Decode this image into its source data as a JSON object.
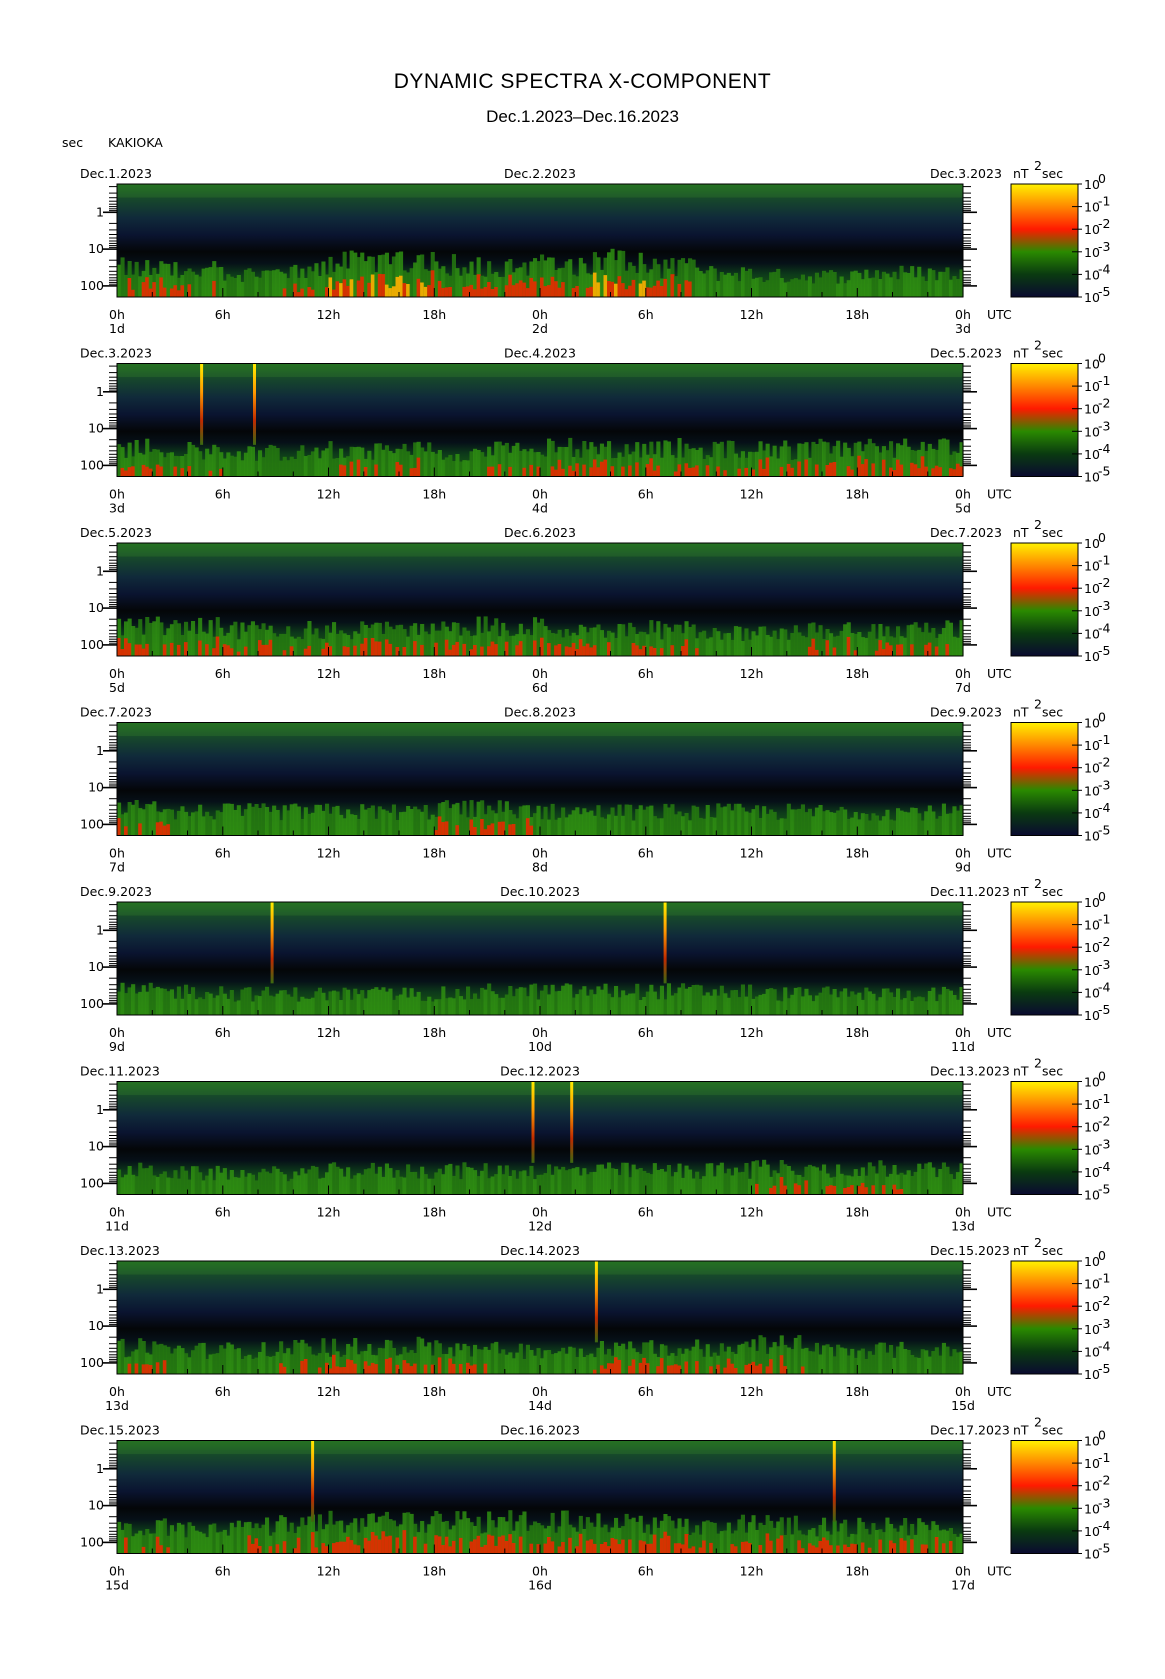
{
  "header": {
    "title": "DYNAMIC SPECTRA X-COMPONENT",
    "subtitle": "Dec.1.2023–Dec.16.2023",
    "unit_label": "sec",
    "station": "KAKIOKA"
  },
  "chart_data": {
    "type": "heatmap",
    "title": "DYNAMIC SPECTRA X-COMPONENT",
    "subtitle": "Dec.1.2023–Dec.16.2023",
    "station": "KAKIOKA",
    "ylabel": "sec",
    "y_ticks": [
      "1",
      "10",
      "100"
    ],
    "x_ticks": [
      "0h",
      "6h",
      "12h",
      "18h",
      "0h",
      "6h",
      "12h",
      "18h",
      "0h"
    ],
    "x_unit": "UTC",
    "colorbar": {
      "label": "nT",
      "label_exp": "2",
      "label_unit": "sec",
      "ticks": [
        "10",
        "10",
        "10",
        "10",
        "10",
        "10"
      ],
      "exponents": [
        "0",
        "-1",
        "-2",
        "-3",
        "-4",
        "-5"
      ],
      "colors": [
        "#fff200",
        "#ff8800",
        "#ff1a00",
        "#2a8a00",
        "#0a3a10",
        "#0a0a30"
      ]
    },
    "panels": [
      {
        "start": "Dec.1.2023",
        "mid": "Dec.2.2023",
        "end": "Dec.3.2023",
        "day_left": "1d",
        "day_mid": "2d",
        "day_right": "3d",
        "events": [],
        "activity": [
          0.6,
          0.5,
          0.4,
          0.5,
          0.8,
          0.9,
          0.7,
          0.6,
          0.7,
          0.9,
          0.6,
          0.4,
          0.3,
          0.3,
          0.4,
          0.4
        ]
      },
      {
        "start": "Dec.3.2023",
        "mid": "Dec.4.2023",
        "end": "Dec.5.2023",
        "day_left": "3d",
        "day_mid": "4d",
        "day_right": "5d",
        "events": [
          4.8,
          7.8
        ],
        "activity": [
          0.6,
          0.5,
          0.4,
          0.4,
          0.5,
          0.5,
          0.4,
          0.5,
          0.6,
          0.6,
          0.6,
          0.5,
          0.5,
          0.6,
          0.6,
          0.6
        ]
      },
      {
        "start": "Dec.5.2023",
        "mid": "Dec.6.2023",
        "end": "Dec.7.2023",
        "day_left": "5d",
        "day_mid": "6d",
        "day_right": "7d",
        "events": [],
        "activity": [
          0.6,
          0.6,
          0.5,
          0.5,
          0.5,
          0.5,
          0.6,
          0.6,
          0.6,
          0.5,
          0.5,
          0.4,
          0.4,
          0.5,
          0.5,
          0.5
        ]
      },
      {
        "start": "Dec.7.2023",
        "mid": "Dec.8.2023",
        "end": "Dec.9.2023",
        "day_left": "7d",
        "day_mid": "8d",
        "day_right": "9d",
        "events": [],
        "activity": [
          0.5,
          0.4,
          0.4,
          0.4,
          0.4,
          0.4,
          0.5,
          0.5,
          0.4,
          0.4,
          0.4,
          0.4,
          0.4,
          0.4,
          0.4,
          0.4
        ]
      },
      {
        "start": "Dec.9.2023",
        "mid": "Dec.10.2023",
        "end": "Dec.11.2023",
        "day_left": "9d",
        "day_mid": "10d",
        "day_right": "11d",
        "events": [
          8.8,
          31.1
        ],
        "activity": [
          0.4,
          0.4,
          0.3,
          0.3,
          0.3,
          0.3,
          0.3,
          0.4,
          0.4,
          0.4,
          0.4,
          0.4,
          0.3,
          0.3,
          0.3,
          0.3
        ]
      },
      {
        "start": "Dec.11.2023",
        "mid": "Dec.12.2023",
        "end": "Dec.13.2023",
        "day_left": "11d",
        "day_mid": "12d",
        "day_right": "13d",
        "events": [
          23.6,
          25.8
        ],
        "activity": [
          0.4,
          0.3,
          0.3,
          0.3,
          0.4,
          0.4,
          0.4,
          0.4,
          0.4,
          0.4,
          0.4,
          0.4,
          0.5,
          0.5,
          0.5,
          0.4
        ]
      },
      {
        "start": "Dec.13.2023",
        "mid": "Dec.14.2023",
        "end": "Dec.15.2023",
        "day_left": "13d",
        "day_mid": "14d",
        "day_right": "15d",
        "events": [
          27.2
        ],
        "activity": [
          0.5,
          0.4,
          0.4,
          0.5,
          0.5,
          0.6,
          0.5,
          0.4,
          0.4,
          0.5,
          0.5,
          0.5,
          0.6,
          0.4,
          0.4,
          0.4
        ]
      },
      {
        "start": "Dec.15.2023",
        "mid": "Dec.16.2023",
        "end": "Dec.17.2023",
        "day_left": "15d",
        "day_mid": "16d",
        "day_right": "17d",
        "events": [
          11.1,
          40.7
        ],
        "activity": [
          0.5,
          0.4,
          0.5,
          0.6,
          0.7,
          0.7,
          0.7,
          0.7,
          0.7,
          0.7,
          0.6,
          0.6,
          0.6,
          0.5,
          0.5,
          0.5
        ]
      }
    ]
  }
}
